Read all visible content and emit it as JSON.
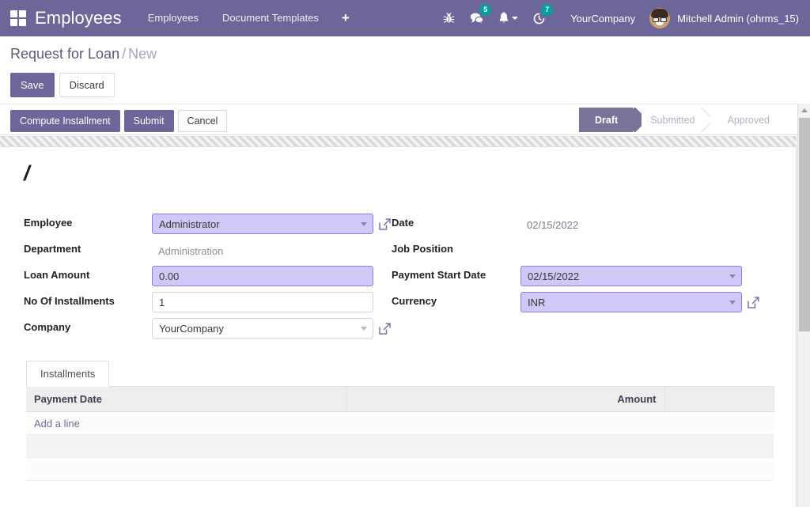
{
  "navbar": {
    "apps_icon": "apps-grid-icon",
    "brand": "Employees",
    "menu_items": [
      {
        "label": "Employees"
      },
      {
        "label": "Document Templates"
      }
    ],
    "add_label": "+",
    "system_icons": [
      {
        "name": "bug-icon",
        "badge": ""
      },
      {
        "name": "messages-icon",
        "badge": "5"
      },
      {
        "name": "bell-icon",
        "badge": ""
      },
      {
        "name": "activity-clock-icon",
        "badge": "7"
      }
    ],
    "messages_badge": "5",
    "activities_badge": "7",
    "company": "YourCompany",
    "user": "Mitchell Admin (ohrms_15)"
  },
  "breadcrumb": {
    "root": "Request for Loan",
    "separator": "/",
    "current": "New"
  },
  "edit_buttons": {
    "save": "Save",
    "discard": "Discard"
  },
  "control_panel": {
    "buttons": [
      {
        "label": "Compute Installment",
        "style": "primary"
      },
      {
        "label": "Submit",
        "style": "primary"
      },
      {
        "label": "Cancel",
        "style": "secondary"
      }
    ],
    "stages": [
      {
        "label": "Draft",
        "active": true
      },
      {
        "label": "Submitted",
        "active": false
      },
      {
        "label": "Approved",
        "active": false
      }
    ]
  },
  "form": {
    "record_title": "/",
    "left": [
      {
        "label": "Employee",
        "type": "many2one",
        "value": "Administrator",
        "state": "focused",
        "has_external_link": true
      },
      {
        "label": "Department",
        "type": "readonly",
        "value": "Administration",
        "state": "readonly",
        "has_external_link": false
      },
      {
        "label": "Loan Amount",
        "type": "monetary",
        "value": "0.00",
        "state": "highlight",
        "has_external_link": false
      },
      {
        "label": "No Of Installments",
        "type": "integer",
        "value": "1",
        "state": "normal",
        "has_external_link": false
      },
      {
        "label": "Company",
        "type": "many2one",
        "value": "YourCompany",
        "state": "normal",
        "has_external_link": true
      }
    ],
    "right": [
      {
        "label": "Date",
        "type": "readonly",
        "value": "02/15/2022",
        "state": "readonly",
        "has_external_link": false
      },
      {
        "label": "Job Position",
        "type": "readonly",
        "value": "",
        "state": "readonly",
        "has_external_link": false
      },
      {
        "label": "Payment Start Date",
        "type": "date",
        "value": "02/15/2022",
        "state": "highlight",
        "has_external_link": false
      },
      {
        "label": "Currency",
        "type": "many2one",
        "value": "INR",
        "state": "highlight",
        "has_external_link": true
      }
    ]
  },
  "notebook": {
    "tabs": [
      {
        "label": "Installments",
        "active": true
      }
    ],
    "table": {
      "columns": [
        "Payment Date",
        "Amount"
      ],
      "rows": [],
      "add_line": "Add a line"
    }
  },
  "colors": {
    "brand_purple": "#6d6699",
    "stage_active": "#7b7299",
    "badge_teal": "#00a09d",
    "field_highlight": "#cfc9f7",
    "field_highlight_border": "#8b7fe0",
    "link_purple": "#6f6aa0"
  }
}
